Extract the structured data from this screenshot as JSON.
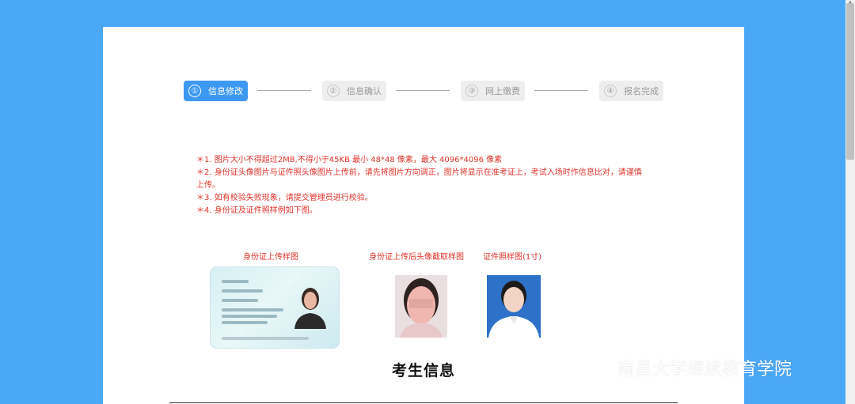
{
  "steps": [
    {
      "num": "①",
      "label": "信息修改",
      "active": true
    },
    {
      "num": "②",
      "label": "信息确认",
      "active": false
    },
    {
      "num": "③",
      "label": "网上缴费",
      "active": false
    },
    {
      "num": "④",
      "label": "报名完成",
      "active": false
    }
  ],
  "notes": [
    "＊1. 图片大小不得超过2MB,不得小于45KB  最小 48*48 像素，最大 4096*4096 像素",
    "＊2. 身份证头像图片与证件照头像图片上传前，请先将图片方向调正，图片将显示在准考证上，考试入场时作信息比对，请谨慎上传。",
    "＊3. 如有校验失败现象，请提交管理员进行校验。",
    "＊4. 身份证及证件照样例如下图。"
  ],
  "samples": {
    "id_label": "身份证上传样图",
    "headshot_label": "身份证上传后头像截取样图",
    "cert_label": "证件照样图(1寸)"
  },
  "section_title": "考生信息",
  "watermark": "南昌大学继续教育学院",
  "colors": {
    "accent": "#3d98f3",
    "background": "#4aa8f7",
    "warning": "#e0332a"
  }
}
